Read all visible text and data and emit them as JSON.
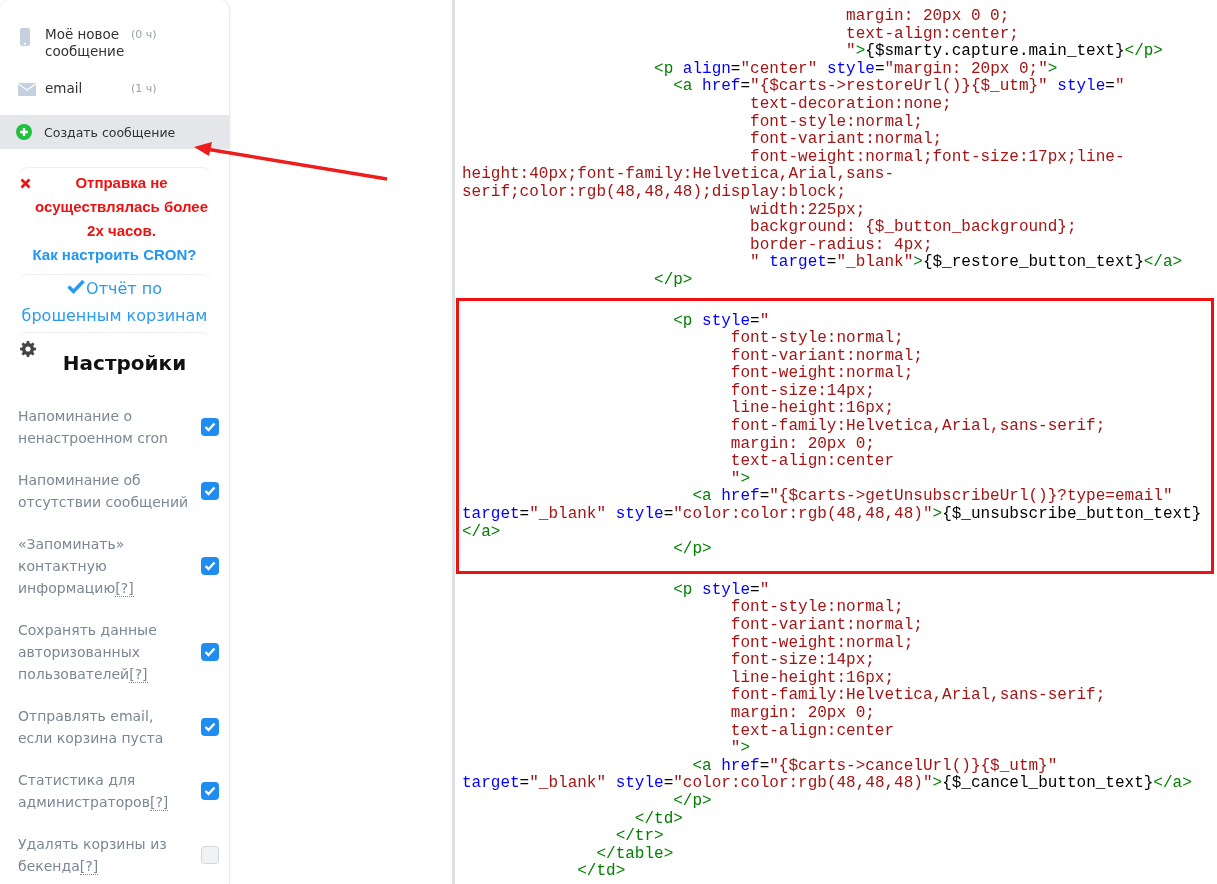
{
  "sidebar": {
    "messages": [
      {
        "kind": "phone",
        "title": "Моё новое сообщение",
        "count": "(0 ч)"
      },
      {
        "kind": "email",
        "title": "email",
        "count": "(1 ч)"
      }
    ],
    "create_button": {
      "label": "Создать сообщение"
    },
    "alert": {
      "message": "Отправка не осуществлялась более 2х часов.",
      "link": "Как настроить CRON?"
    },
    "report_link": "Отчёт по брошенным корзинам",
    "settings": {
      "title": "Настройки",
      "items": [
        {
          "label": "Напоминание о ненастроенном cron",
          "checked": true
        },
        {
          "label": "Напоминание об отсутствии сообщений",
          "checked": true
        },
        {
          "label": "«Запоминать» контактную информацию",
          "help": "[?]",
          "checked": true
        },
        {
          "label": "Сохранять данные авторизованных пользователей",
          "help": "[?]",
          "checked": true
        },
        {
          "label": "Отправлять email, если корзина пуста",
          "checked": true
        },
        {
          "label": "Статистика для администраторов",
          "help": "[?]",
          "checked": true
        },
        {
          "label": "Удалять корзины из бекенда",
          "help": "[?]",
          "checked": false
        }
      ]
    }
  },
  "code": {
    "sections": [
      {
        "highlighted": false,
        "lines": [
          [
            {
              "kind": "value",
              "s": "                                        margin: 20px 0 0;"
            }
          ],
          [
            {
              "kind": "value",
              "s": "                                        text-align:center;"
            }
          ],
          [
            {
              "kind": "value",
              "s": "                                        \""
            },
            {
              "kind": "tag",
              "s": ">"
            },
            {
              "kind": "text",
              "s": "{$smarty.capture.main_text}"
            },
            {
              "kind": "tag",
              "s": "</p>"
            }
          ],
          [
            {
              "kind": "tag",
              "s": "                    <p "
            },
            {
              "kind": "attribute",
              "s": "align"
            },
            {
              "kind": "text",
              "s": "="
            },
            {
              "kind": "value",
              "s": "\"center\" "
            },
            {
              "kind": "attribute",
              "s": "style"
            },
            {
              "kind": "text",
              "s": "="
            },
            {
              "kind": "value",
              "s": "\"margin: 20px 0;\""
            },
            {
              "kind": "tag",
              "s": ">"
            }
          ],
          [
            {
              "kind": "tag",
              "s": "                      <a "
            },
            {
              "kind": "attribute",
              "s": "href"
            },
            {
              "kind": "text",
              "s": "="
            },
            {
              "kind": "value",
              "s": "\"{$carts->restoreUrl()}{$_utm}\" "
            },
            {
              "kind": "attribute",
              "s": "style"
            },
            {
              "kind": "text",
              "s": "="
            },
            {
              "kind": "value",
              "s": "\""
            }
          ],
          [
            {
              "kind": "value",
              "s": "                              text-decoration:none;"
            }
          ],
          [
            {
              "kind": "value",
              "s": "                              font-style:normal;"
            }
          ],
          [
            {
              "kind": "value",
              "s": "                              font-variant:normal;"
            }
          ],
          [
            {
              "kind": "value",
              "s": "                              font-weight:normal;font-size:17px;line-"
            }
          ],
          [
            {
              "kind": "value",
              "s": "height:40px;font-family:Helvetica,Arial,sans-"
            }
          ],
          [
            {
              "kind": "value",
              "s": "serif;color:rgb(48,48,48);display:block;"
            }
          ],
          [
            {
              "kind": "value",
              "s": "                              width:225px;"
            }
          ],
          [
            {
              "kind": "value",
              "s": "                              background: {$_button_background};"
            }
          ],
          [
            {
              "kind": "value",
              "s": "                              border-radius: 4px;"
            }
          ],
          [
            {
              "kind": "value",
              "s": "                              \" "
            },
            {
              "kind": "attribute",
              "s": "target"
            },
            {
              "kind": "text",
              "s": "="
            },
            {
              "kind": "value",
              "s": "\"_blank\""
            },
            {
              "kind": "tag",
              "s": ">"
            },
            {
              "kind": "text",
              "s": "{$_restore_button_text}"
            },
            {
              "kind": "tag",
              "s": "</a>"
            }
          ],
          [
            {
              "kind": "tag",
              "s": "                    </p>"
            }
          ]
        ]
      },
      {
        "highlighted": true,
        "lines": [
          [
            {
              "kind": "tag",
              "s": "                      <p "
            },
            {
              "kind": "attribute",
              "s": "style"
            },
            {
              "kind": "text",
              "s": "="
            },
            {
              "kind": "value",
              "s": "\""
            }
          ],
          [
            {
              "kind": "value",
              "s": "                            font-style:normal;"
            }
          ],
          [
            {
              "kind": "value",
              "s": "                            font-variant:normal;"
            }
          ],
          [
            {
              "kind": "value",
              "s": "                            font-weight:normal;"
            }
          ],
          [
            {
              "kind": "value",
              "s": "                            font-size:14px;"
            }
          ],
          [
            {
              "kind": "value",
              "s": "                            line-height:16px;"
            }
          ],
          [
            {
              "kind": "value",
              "s": "                            font-family:Helvetica,Arial,sans-serif;"
            }
          ],
          [
            {
              "kind": "value",
              "s": "                            margin: 20px 0;"
            }
          ],
          [
            {
              "kind": "value",
              "s": "                            text-align:center"
            }
          ],
          [
            {
              "kind": "value",
              "s": "                            \""
            },
            {
              "kind": "tag",
              "s": ">"
            }
          ],
          [
            {
              "kind": "tag",
              "s": "                        <a "
            },
            {
              "kind": "attribute",
              "s": "href"
            },
            {
              "kind": "text",
              "s": "="
            },
            {
              "kind": "value",
              "s": "\"{$carts->getUnsubscribeUrl()}?type=email\""
            }
          ],
          [
            {
              "kind": "attribute",
              "s": "target"
            },
            {
              "kind": "text",
              "s": "="
            },
            {
              "kind": "value",
              "s": "\"_blank\" "
            },
            {
              "kind": "attribute",
              "s": "style"
            },
            {
              "kind": "text",
              "s": "="
            },
            {
              "kind": "value",
              "s": "\"color:color:rgb(48,48,48)\""
            },
            {
              "kind": "tag",
              "s": ">"
            },
            {
              "kind": "text",
              "s": "{$_unsubscribe_button_text}"
            }
          ],
          [
            {
              "kind": "tag",
              "s": "</a>"
            }
          ],
          [
            {
              "kind": "tag",
              "s": "                      </p>"
            }
          ]
        ]
      },
      {
        "highlighted": false,
        "lines": [
          [
            {
              "kind": "tag",
              "s": "                      <p "
            },
            {
              "kind": "attribute",
              "s": "style"
            },
            {
              "kind": "text",
              "s": "="
            },
            {
              "kind": "value",
              "s": "\""
            }
          ],
          [
            {
              "kind": "value",
              "s": "                            font-style:normal;"
            }
          ],
          [
            {
              "kind": "value",
              "s": "                            font-variant:normal;"
            }
          ],
          [
            {
              "kind": "value",
              "s": "                            font-weight:normal;"
            }
          ],
          [
            {
              "kind": "value",
              "s": "                            font-size:14px;"
            }
          ],
          [
            {
              "kind": "value",
              "s": "                            line-height:16px;"
            }
          ],
          [
            {
              "kind": "value",
              "s": "                            font-family:Helvetica,Arial,sans-serif;"
            }
          ],
          [
            {
              "kind": "value",
              "s": "                            margin: 20px 0;"
            }
          ],
          [
            {
              "kind": "value",
              "s": "                            text-align:center"
            }
          ],
          [
            {
              "kind": "value",
              "s": "                            \""
            },
            {
              "kind": "tag",
              "s": ">"
            }
          ],
          [
            {
              "kind": "tag",
              "s": "                        <a "
            },
            {
              "kind": "attribute",
              "s": "href"
            },
            {
              "kind": "text",
              "s": "="
            },
            {
              "kind": "value",
              "s": "\"{$carts->cancelUrl()}{$_utm}\""
            }
          ],
          [
            {
              "kind": "attribute",
              "s": "target"
            },
            {
              "kind": "text",
              "s": "="
            },
            {
              "kind": "value",
              "s": "\"_blank\" "
            },
            {
              "kind": "attribute",
              "s": "style"
            },
            {
              "kind": "text",
              "s": "="
            },
            {
              "kind": "value",
              "s": "\"color:color:rgb(48,48,48)\""
            },
            {
              "kind": "tag",
              "s": ">"
            },
            {
              "kind": "text",
              "s": "{$_cancel_button_text}"
            },
            {
              "kind": "tag",
              "s": "</a>"
            }
          ],
          [
            {
              "kind": "tag",
              "s": "                      </p>"
            }
          ],
          [
            {
              "kind": "tag",
              "s": "                  </td>"
            }
          ],
          [
            {
              "kind": "tag",
              "s": "                </tr>"
            }
          ],
          [
            {
              "kind": "tag",
              "s": "              </table>"
            }
          ],
          [
            {
              "kind": "tag",
              "s": "            </td>"
            }
          ]
        ]
      }
    ]
  }
}
